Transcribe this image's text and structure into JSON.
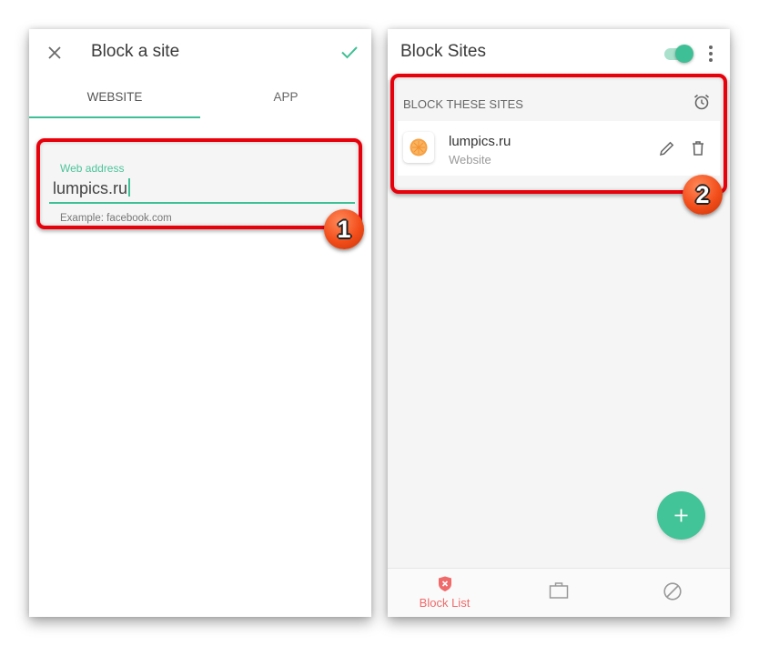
{
  "left_screen": {
    "header": {
      "close_icon": "close-icon",
      "title": "Block a site",
      "confirm_icon": "check-icon"
    },
    "tabs": [
      {
        "label": "WEBSITE",
        "active": true
      },
      {
        "label": "APP",
        "active": false
      }
    ],
    "web_address_field": {
      "label": "Web address",
      "value": "lumpics.ru",
      "helper": "Example: facebook.com"
    },
    "annotation_badge": "1"
  },
  "right_screen": {
    "header": {
      "title": "Block Sites",
      "toggle_on": true,
      "more_icon": "more-vert-icon"
    },
    "section": {
      "title": "BLOCK THESE SITES",
      "schedule_icon": "alarm-icon"
    },
    "sites": [
      {
        "name": "lumpics.ru",
        "type": "Website",
        "icon": "site-favicon-orange"
      }
    ],
    "fab_icon": "plus-icon",
    "bottom_nav": [
      {
        "label": "Block List",
        "icon": "shield-x-icon",
        "active": true
      },
      {
        "label": "",
        "icon": "briefcase-icon",
        "active": false
      },
      {
        "label": "",
        "icon": "block-circle-icon",
        "active": false
      }
    ],
    "annotation_badge": "2"
  },
  "colors": {
    "accent_green": "#3fbf95",
    "highlight_red": "#e8000b",
    "active_nav_red": "#f06a6a",
    "badge_orange": "#f24d1a"
  }
}
